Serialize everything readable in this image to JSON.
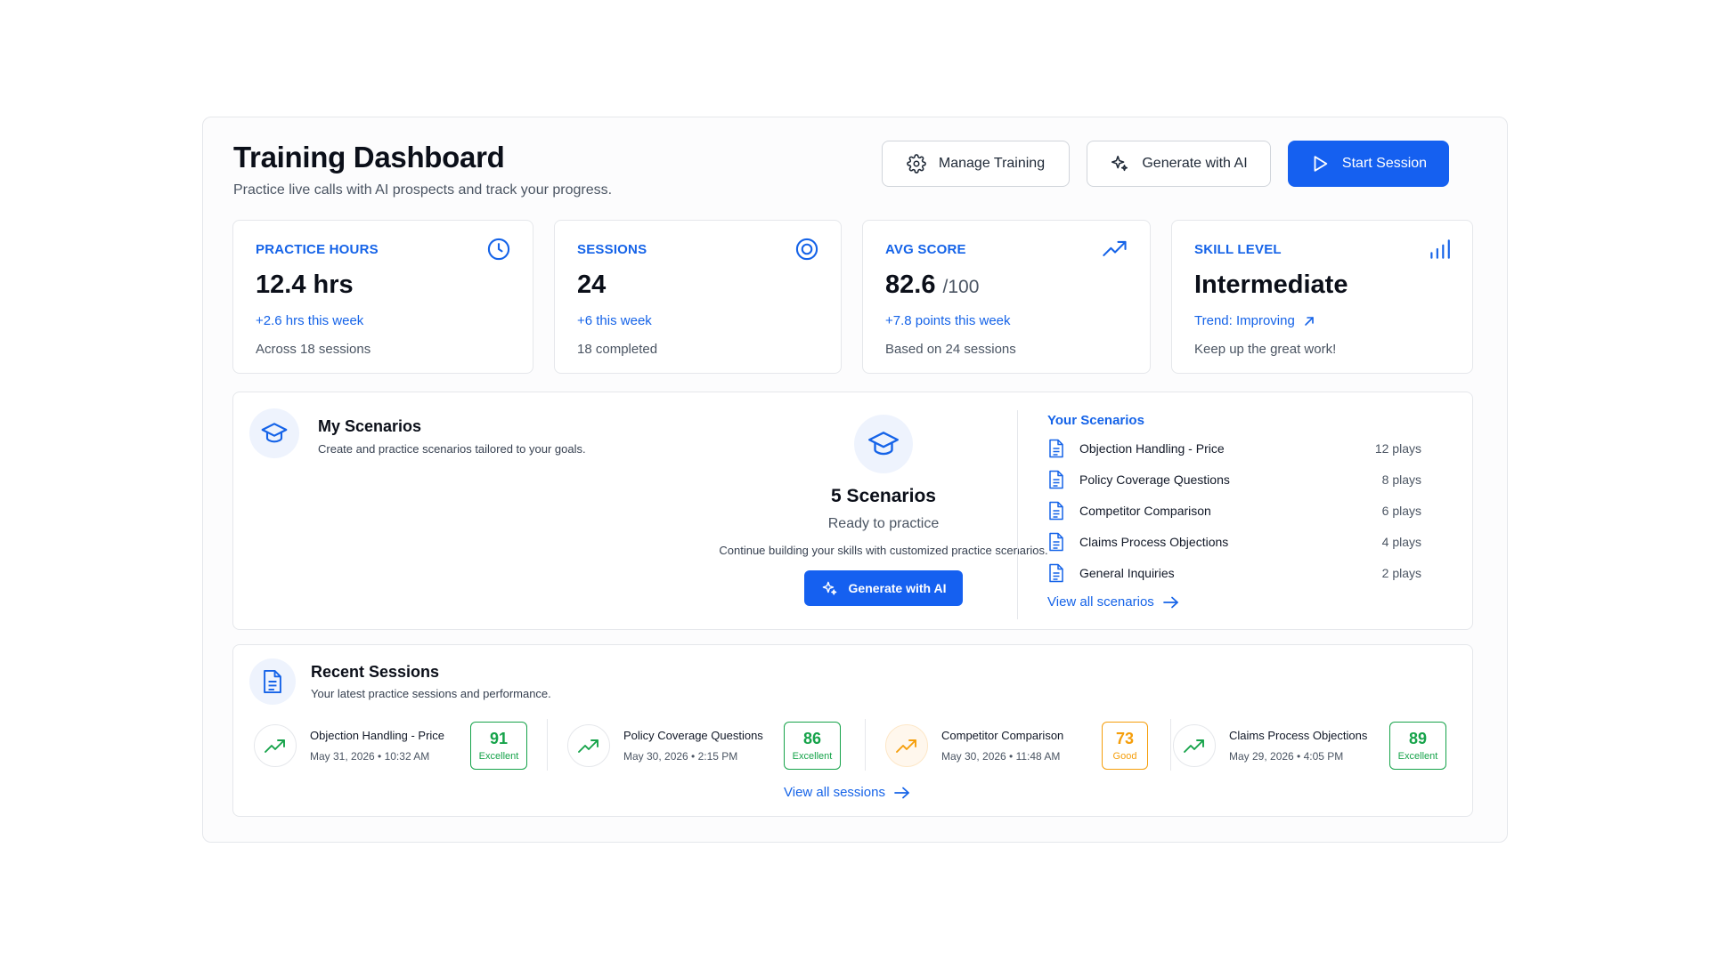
{
  "header": {
    "title": "Training Dashboard",
    "subtitle": "Practice live calls with AI prospects and track your progress.",
    "manage_label": "Manage Training",
    "generate_label": "Generate with AI",
    "start_label": "Start Session"
  },
  "stats": [
    {
      "label": "PRACTICE HOURS",
      "value": "12.4 hrs",
      "unit": "",
      "trend": "+2.6 hrs this week",
      "foot": "Across 18 sessions",
      "icon": "clock-icon"
    },
    {
      "label": "SESSIONS",
      "value": "24",
      "unit": "",
      "trend": "+6 this week",
      "foot": "18 completed",
      "icon": "target-icon"
    },
    {
      "label": "AVG SCORE",
      "value": "82.6",
      "unit": "/100",
      "trend": "+7.8 points this week",
      "foot": "Based on 24 sessions",
      "icon": "trending-up-icon"
    },
    {
      "label": "SKILL LEVEL",
      "value": "Intermediate",
      "unit": "",
      "trend": "Trend: Improving",
      "foot": "Keep up the great work!",
      "icon": "signal-bars-icon"
    }
  ],
  "scenarios": {
    "title": "My Scenarios",
    "desc": "Create and practice scenarios tailored to your goals.",
    "count": "5 Scenarios",
    "ready": "Ready to practice",
    "message": "Continue building your skills with customized practice scenarios.",
    "generate_label": "Generate with AI",
    "list_title": "Your Scenarios",
    "items": [
      {
        "name": "Objection Handling - Price",
        "plays": "12 plays"
      },
      {
        "name": "Policy Coverage Questions",
        "plays": "8 plays"
      },
      {
        "name": "Competitor Comparison",
        "plays": "6 plays"
      },
      {
        "name": "Claims Process Objections",
        "plays": "4 plays"
      },
      {
        "name": "General Inquiries",
        "plays": "2 plays"
      }
    ],
    "view_all": "View all scenarios"
  },
  "sessions": {
    "title": "Recent Sessions",
    "desc": "Your latest practice sessions and performance.",
    "items": [
      {
        "name": "Objection Handling - Price",
        "date": "May 31, 2026  •  10:32 AM",
        "score": "91",
        "rating": "Excellent"
      },
      {
        "name": "Policy Coverage Questions",
        "date": "May 30, 2026  •  2:15 PM",
        "score": "86",
        "rating": "Excellent"
      },
      {
        "name": "Competitor Comparison",
        "date": "May 30, 2026  •  11:48 AM",
        "score": "73",
        "rating": "Good"
      },
      {
        "name": "Claims Process Objections",
        "date": "May 29, 2026  •  4:05 PM",
        "score": "89",
        "rating": "Excellent"
      }
    ],
    "view_all": "View all sessions"
  },
  "colors": {
    "accent": "#1560f0",
    "excellent": "#16a34a",
    "good": "#f59e0b"
  }
}
